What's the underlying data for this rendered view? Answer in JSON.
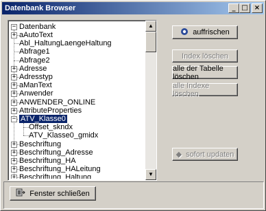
{
  "window": {
    "title": "Datenbank Browser",
    "controls": {
      "minimize": "_",
      "maximize": "□",
      "close": "×"
    }
  },
  "tree": {
    "root": "Datenbank",
    "items": [
      {
        "label": "aAutoText",
        "expandable": true
      },
      {
        "label": "Abl_HaltungLaengeHaltung",
        "expandable": false
      },
      {
        "label": "Abfrage1",
        "expandable": false
      },
      {
        "label": "Abfrage2",
        "expandable": false
      },
      {
        "label": "Adresse",
        "expandable": true
      },
      {
        "label": "Adresstyp",
        "expandable": true
      },
      {
        "label": "aManText",
        "expandable": true
      },
      {
        "label": "Anwender",
        "expandable": true
      },
      {
        "label": "ANWENDER_ONLINE",
        "expandable": true
      },
      {
        "label": "AttributeProperties",
        "expandable": true
      },
      {
        "label": "ATV_Klasse0",
        "expandable": true,
        "expanded": true,
        "selected": true
      },
      {
        "label": "Offset_skndx",
        "child": true
      },
      {
        "label": "ATV_Klasse0_gmidx",
        "child": true
      },
      {
        "label": "Beschriftung",
        "expandable": true
      },
      {
        "label": "Beschriftung_Adresse",
        "expandable": true
      },
      {
        "label": "Beschriftung_HA",
        "expandable": true
      },
      {
        "label": "Beschriftung_HALeitung",
        "expandable": true
      },
      {
        "label": "Beschriftung_Haltung",
        "expandable": true
      }
    ]
  },
  "buttons": {
    "refresh": "auffrischen",
    "delete_index": "Index löschen",
    "delete_table_all": "alle der Tabelle löschen",
    "delete_all_indexes": "alle Indexe löschen",
    "update_now": "sofort updaten",
    "close_window": "Fenster schließen"
  }
}
